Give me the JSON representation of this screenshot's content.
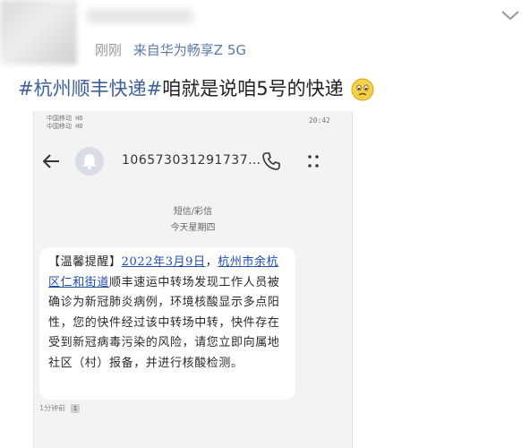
{
  "post": {
    "time": "刚刚",
    "source": "来自华为畅享Z 5G",
    "hashtag": "#杭州顺丰快递#",
    "text": "咱就是说咱5号的快递"
  },
  "sms_screenshot": {
    "status_left": [
      "中国移动 HD",
      "中国移动 HD"
    ],
    "status_right": "20:42",
    "sender_number": "106573031291737…",
    "channel_label": "短信/彩信",
    "day_label": "今天星期四",
    "message": {
      "prefix": "【温馨提醒】",
      "date_link": "2022年3月9日",
      "sep": "，",
      "place_link": "杭州市余杭区仁和街道",
      "body": "顺丰速运中转场发现工作人员被确诊为新冠肺炎病例，环境核酸显示多点阳性，您的快件经过该中转场中转，快件存在受到新冠病毒污染的风险，请您立即向属地社区（村）报备，并进行核酸检测。"
    },
    "timestamp": "1分钟前",
    "sim_badge": "1"
  },
  "icons": [
    "chevron-down-icon",
    "back-arrow-icon",
    "bell-avatar-icon",
    "phone-call-icon",
    "more-dots-icon",
    "sad-face-emoji-icon"
  ]
}
